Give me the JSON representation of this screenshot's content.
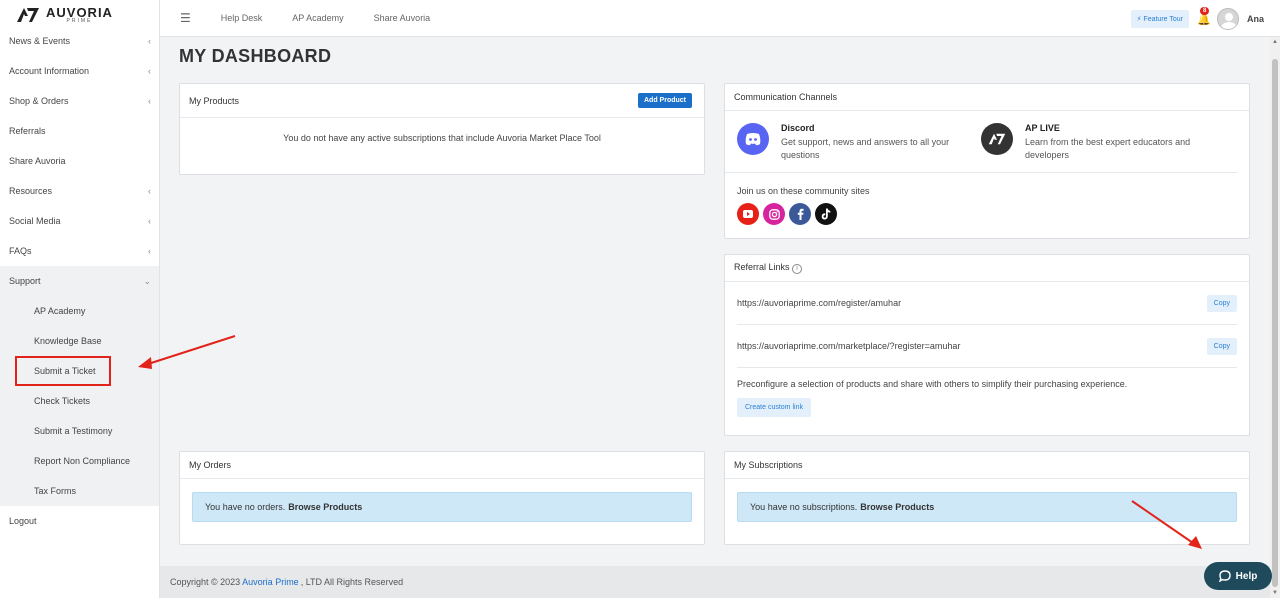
{
  "brand": {
    "name": "AUVORIA",
    "sub": "PRIME"
  },
  "sidebar": {
    "items": [
      {
        "label": "News & Events",
        "chevron": "‹"
      },
      {
        "label": "Account Information",
        "chevron": "‹"
      },
      {
        "label": "Shop & Orders",
        "chevron": "‹"
      },
      {
        "label": "Referrals",
        "chevron": ""
      },
      {
        "label": "Share Auvoria",
        "chevron": ""
      },
      {
        "label": "Resources",
        "chevron": "‹"
      },
      {
        "label": "Social Media",
        "chevron": "‹"
      },
      {
        "label": "FAQs",
        "chevron": "‹"
      }
    ],
    "support": {
      "label": "Support",
      "chevron": "⌄",
      "children": [
        "AP Academy",
        "Knowledge Base",
        "Submit a Ticket",
        "Check Tickets",
        "Submit a Testimony",
        "Report Non Compliance",
        "Tax Forms"
      ]
    },
    "logout": "Logout"
  },
  "topbar": {
    "links": [
      "Help Desk",
      "AP Academy",
      "Share Auvoria"
    ],
    "feature_tour": "⚡ Feature Tour",
    "notification_count": "8",
    "user_name": "Ana"
  },
  "page": {
    "title": "MY DASHBOARD"
  },
  "my_products": {
    "title": "My Products",
    "add_button": "Add Product",
    "empty": "You do not have any active subscriptions that include Auvoria Market Place Tool"
  },
  "communication": {
    "title": "Communication Channels",
    "channels": [
      {
        "name": "Discord",
        "desc": "Get support, news and answers to all your questions",
        "icon": "discord-icon"
      },
      {
        "name": "AP LIVE",
        "desc": "Learn from the best expert educators and developers",
        "icon": "ap-live-icon"
      }
    ],
    "community_label": "Join us on these community sites",
    "socials": [
      {
        "name": "youtube-icon",
        "color": "#e62117"
      },
      {
        "name": "instagram-icon",
        "color": "#d6249f"
      },
      {
        "name": "facebook-icon",
        "color": "#3b5998"
      },
      {
        "name": "tiktok-icon",
        "color": "#111111"
      }
    ]
  },
  "referral": {
    "title": "Referral Links",
    "links": [
      "https://auvoriaprime.com/register/amuhar",
      "https://auvoriaprime.com/marketplace/?register=amuhar"
    ],
    "copy_label": "Copy",
    "desc": "Preconfigure a selection of products and share with others to simplify their purchasing experience.",
    "custom_link": "Create custom link"
  },
  "my_orders": {
    "title": "My Orders",
    "text": "You have no orders.",
    "link": "Browse Products"
  },
  "my_subscriptions": {
    "title": "My Subscriptions",
    "text": "You have no subscriptions.",
    "link": "Browse Products"
  },
  "footer": {
    "prefix": "Copyright © 2023",
    "link": "Auvoria Prime",
    "suffix": ", LTD All Rights Reserved"
  },
  "help": {
    "label": "Help"
  },
  "colors": {
    "accent": "#1c6fc9",
    "help_bg": "#1e4a5c",
    "annotation_red": "#e2231a"
  }
}
